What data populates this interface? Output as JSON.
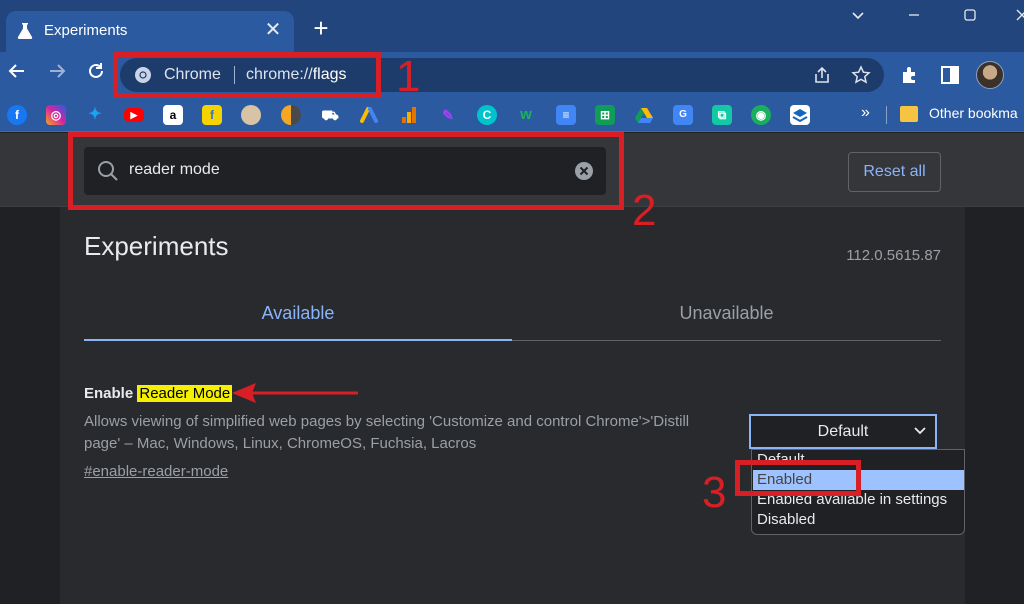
{
  "window": {
    "tab_title": "Experiments",
    "tab_close": "✕",
    "new_tab": "+"
  },
  "toolbar": {
    "omnibox_chip": "Chrome",
    "omnibox_url_prefix": "chrome://",
    "omnibox_url_path": "flags"
  },
  "bookmarks": {
    "overflow": "»",
    "other_label": "Other bookma"
  },
  "search": {
    "value": "reader mode"
  },
  "header": {
    "reset_label": "Reset all",
    "title": "Experiments",
    "version": "112.0.5615.87"
  },
  "tabs": {
    "available": "Available",
    "unavailable": "Unavailable"
  },
  "flag": {
    "title_prefix": "Enable ",
    "title_highlight": "Reader Mode",
    "description": "Allows viewing of simplified web pages by selecting 'Customize and control Chrome'>'Distill page' – Mac, Windows, Linux, ChromeOS, Fuchsia, Lacros",
    "link": "#enable-reader-mode",
    "select_value": "Default",
    "options": [
      "Default",
      "Enabled",
      "Enabled available in settings",
      "Disabled"
    ],
    "highlighted_option": "Enabled"
  },
  "annotations": {
    "num1": "1",
    "num2": "2",
    "num3": "3"
  },
  "colors": {
    "accent": "#8ab4f8",
    "annotation": "#d91f26",
    "highlight": "#f4f000"
  }
}
